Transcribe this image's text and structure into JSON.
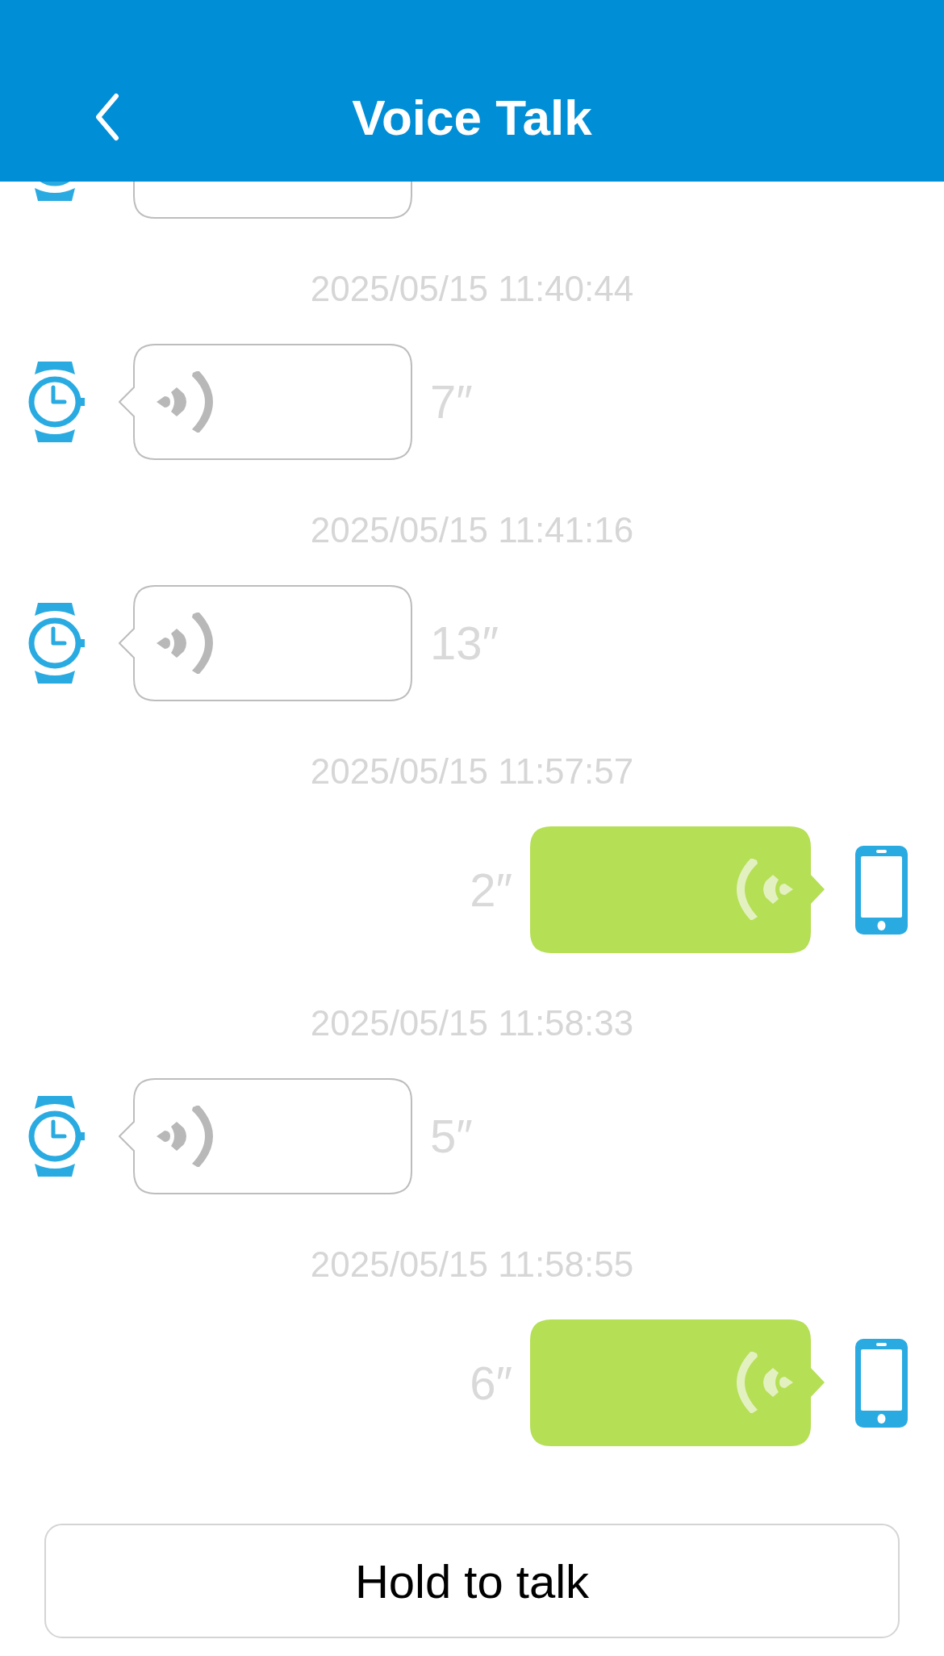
{
  "header": {
    "title": "Voice Talk"
  },
  "messages": [
    {
      "kind": "watch"
    },
    {
      "kind": "watch",
      "timestamp": "2025/05/15 11:40:44",
      "duration": "7″"
    },
    {
      "kind": "watch",
      "timestamp": "2025/05/15 11:41:16",
      "duration": "13″"
    },
    {
      "kind": "phone",
      "timestamp": "2025/05/15 11:57:57",
      "duration": "2″"
    },
    {
      "kind": "watch",
      "timestamp": "2025/05/15 11:58:33",
      "duration": "5″"
    },
    {
      "kind": "phone",
      "timestamp": "2025/05/15 11:58:55",
      "duration": "6″"
    }
  ],
  "talk_button": {
    "label": "Hold to talk"
  }
}
